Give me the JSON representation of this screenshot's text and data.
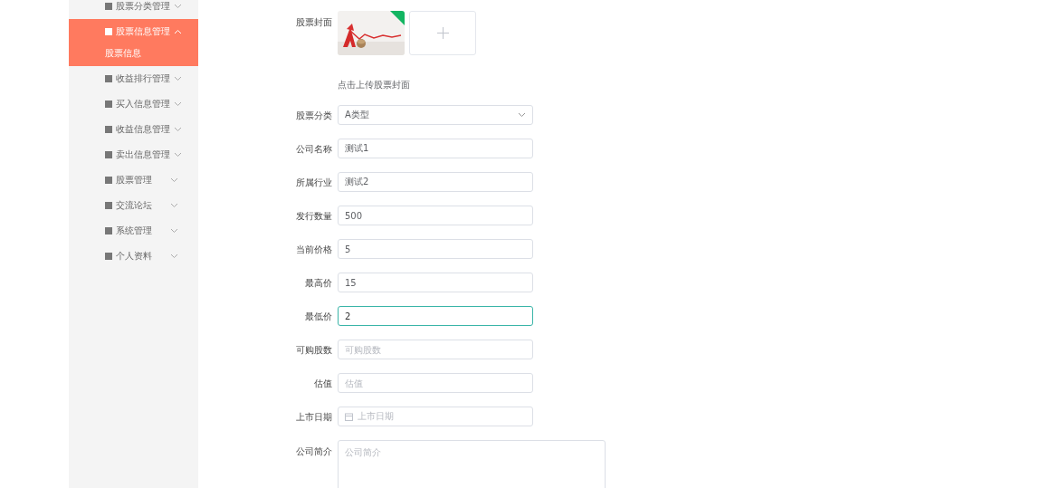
{
  "sidebar": {
    "items": [
      {
        "label": "股票分类管理",
        "selected": false,
        "expanded": false
      },
      {
        "label": "股票信息管理",
        "selected": true,
        "expanded": true,
        "children": [
          {
            "label": "股票信息",
            "selected": true
          }
        ]
      },
      {
        "label": "收益排行管理",
        "selected": false,
        "expanded": false
      },
      {
        "label": "买入信息管理",
        "selected": false,
        "expanded": false
      },
      {
        "label": "收益信息管理",
        "selected": false,
        "expanded": false
      },
      {
        "label": "卖出信息管理",
        "selected": false,
        "expanded": false
      },
      {
        "label": "股票管理",
        "selected": false,
        "expanded": false
      },
      {
        "label": "交流论坛",
        "selected": false,
        "expanded": false
      },
      {
        "label": "系统管理",
        "selected": false,
        "expanded": false
      },
      {
        "label": "个人资料",
        "selected": false,
        "expanded": false
      }
    ]
  },
  "form": {
    "fields": [
      {
        "kind": "upload",
        "label": "股票封面"
      },
      {
        "kind": "hint",
        "text": "点击上传股票封面"
      },
      {
        "kind": "select",
        "label": "股票分类",
        "value": "A类型"
      },
      {
        "kind": "input",
        "label": "公司名称",
        "value": "测试1",
        "focused": false
      },
      {
        "kind": "input",
        "label": "所属行业",
        "value": "测试2",
        "focused": false
      },
      {
        "kind": "input",
        "label": "发行数量",
        "value": "500",
        "focused": false
      },
      {
        "kind": "input",
        "label": "当前价格",
        "value": "5",
        "focused": false
      },
      {
        "kind": "input",
        "label": "最高价",
        "value": "15",
        "focused": false
      },
      {
        "kind": "input",
        "label": "最低价",
        "value": "2",
        "focused": true
      },
      {
        "kind": "input",
        "label": "可购股数",
        "placeholder": "可购股数",
        "focused": false
      },
      {
        "kind": "input",
        "label": "估值",
        "placeholder": "估值",
        "focused": false
      },
      {
        "kind": "date",
        "label": "上市日期",
        "placeholder": "上市日期"
      },
      {
        "kind": "textarea",
        "label": "公司简介",
        "placeholder": "公司简介"
      }
    ]
  }
}
